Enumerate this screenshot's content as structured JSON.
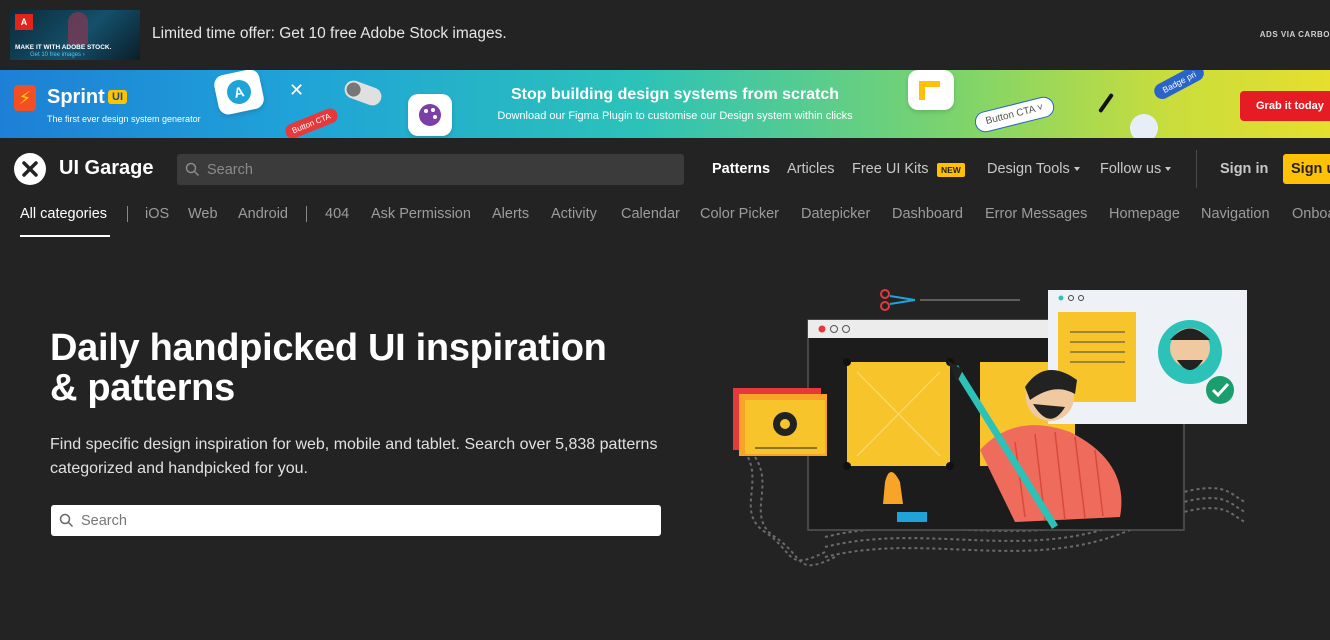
{
  "ad": {
    "thumb_line1": "MAKE IT WITH ADOBE STOCK.",
    "thumb_line2": "Get 10 free images ›",
    "text": "Limited time offer: Get 10 free Adobe Stock images.",
    "via": "ADS VIA CARBO"
  },
  "banner": {
    "brand": "Sprint",
    "brand_badge": "UI",
    "tagline": "The first ever design system generator",
    "headline": "Stop building design systems from scratch",
    "subline": "Download our Figma Plugin to customise our Design system within clicks",
    "pill_button_cta": "Button CTA",
    "pill_outline": "Button CTA",
    "pill_badge": "Badge pri",
    "cta": "Grab it today"
  },
  "nav": {
    "brand": "UI Garage",
    "search_placeholder": "Search",
    "links": [
      "Patterns",
      "Articles",
      "Free UI Kits",
      "Design Tools",
      "Follow us"
    ],
    "new_badge": "NEW",
    "signin": "Sign in",
    "signup": "Sign u"
  },
  "categories": [
    "All categories",
    "iOS",
    "Web",
    "Android",
    "404",
    "Ask Permission",
    "Alerts",
    "Activity",
    "Calendar",
    "Color Picker",
    "Datepicker",
    "Dashboard",
    "Error Messages",
    "Homepage",
    "Navigation",
    "Onboa"
  ],
  "hero": {
    "title_line1": "Daily handpicked UI inspiration",
    "title_line2": "& patterns",
    "subtitle": "Find specific design inspiration for web, mobile and tablet. Search over 5,838 patterns categorized and handpicked for you.",
    "search_placeholder": "Search"
  },
  "colors": {
    "background": "#232323",
    "accent": "#ffc107",
    "banner_cta": "#e51c23"
  }
}
